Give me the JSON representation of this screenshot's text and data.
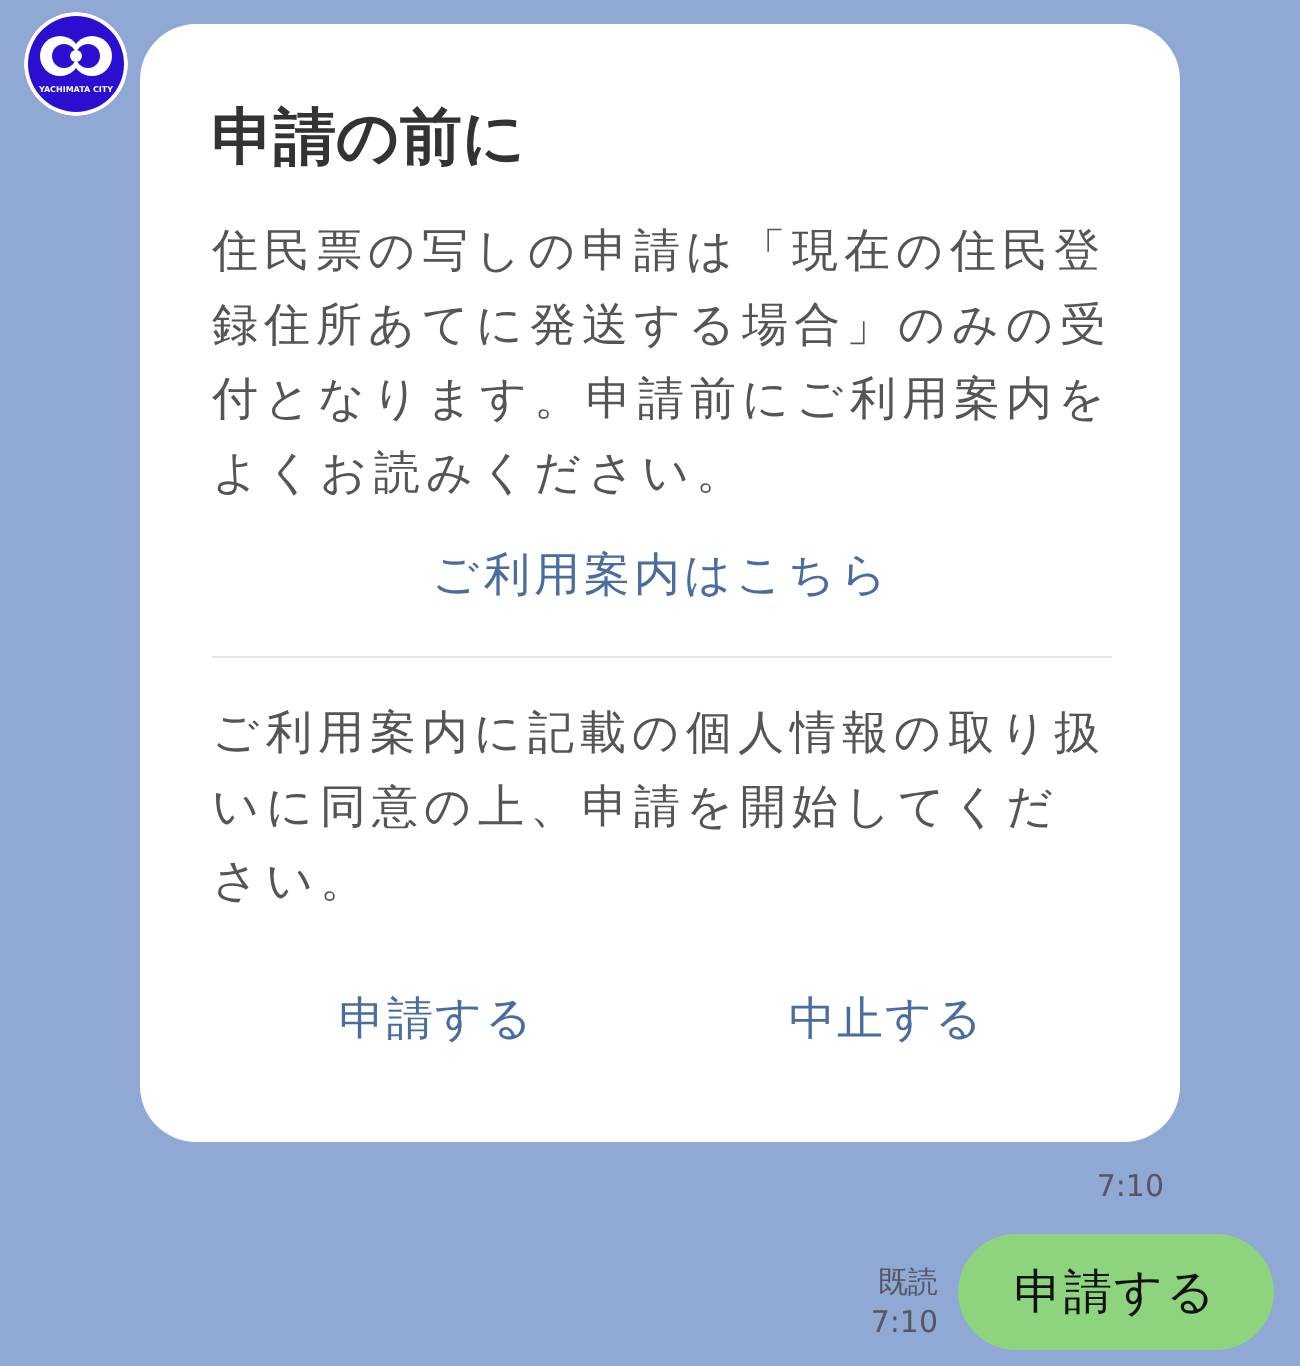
{
  "avatar": {
    "caption": "YACHIMATA CITY"
  },
  "card": {
    "title": "申請の前に",
    "body": "住民票の写しの申請は「現在の住民登録住所あてに発送する場合」のみの受付となります。申請前にご利用案内をよくお読みください。",
    "link": "ご利用案内はこちら",
    "consent": "ご利用案内に記載の個人情報の取り扱いに同意の上、申請を開始してください。",
    "actions": [
      {
        "label": "申請する"
      },
      {
        "label": "中止する"
      }
    ]
  },
  "card_time": "7:10",
  "reply": {
    "read": "既読",
    "time": "7:10",
    "text": "申請する"
  }
}
